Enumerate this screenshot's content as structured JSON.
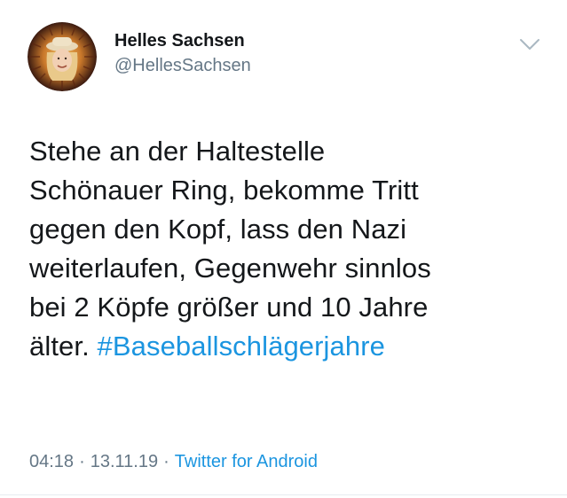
{
  "author": {
    "display_name": "Helles Sachsen",
    "handle": "@HellesSachsen",
    "avatar_icon": "profile-photo"
  },
  "menu": {
    "icon": "chevron-down-icon"
  },
  "tweet": {
    "lines": [
      "Stehe an der Haltestelle",
      "Schönauer Ring, bekomme Tritt",
      "gegen den Kopf, lass den Nazi",
      "weiterlaufen, Gegenwehr sinnlos",
      "bei 2 Köpfe größer und 10 Jahre"
    ],
    "last_line_prefix": "älter.",
    "hashtag": "#Baseballschlägerjahre"
  },
  "meta": {
    "time": "04:18",
    "date": "13.11.19",
    "source": "Twitter for Android",
    "separator": "·"
  },
  "colors": {
    "text": "#14171a",
    "secondary": "#657786",
    "link": "#1b95e0",
    "background": "#ffffff"
  }
}
